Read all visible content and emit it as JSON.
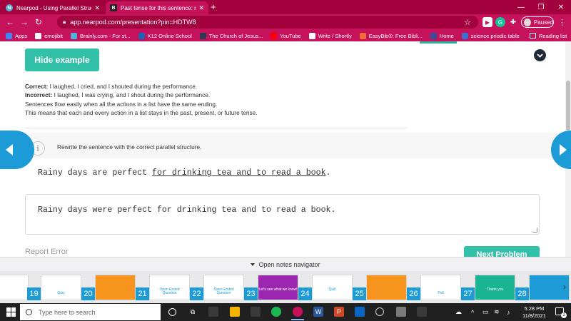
{
  "browser": {
    "tabs": [
      {
        "title": "Nearpod - Using Parallel Structu",
        "icon": "nearpod-icon"
      },
      {
        "title": "Past tense for this sentence: rain",
        "icon": "brainly-icon"
      }
    ],
    "url": "app.nearpod.com/presentation?pin=HDTW8",
    "profile_status": "Paused",
    "bookmarks": [
      {
        "label": "Apps",
        "color": "#4285f4"
      },
      {
        "label": "emojibit",
        "color": "#ffffff"
      },
      {
        "label": "Brainly.com - For st...",
        "color": "#4fb3d9"
      },
      {
        "label": "K12 Online School",
        "color": "#1c63b7"
      },
      {
        "label": "The Church of Jesus...",
        "color": "#2b3a55"
      },
      {
        "label": "YouTube",
        "color": "#ff0000"
      },
      {
        "label": "Write / Shortly",
        "color": "#ffffff"
      },
      {
        "label": "EasyBib®: Free Bibli...",
        "color": "#f26a35"
      },
      {
        "label": "Home",
        "color": "#3b4a9c"
      },
      {
        "label": "science priodic table",
        "color": "#3b6fd4"
      }
    ],
    "reading_list": "Reading list"
  },
  "lesson": {
    "hide_example_label": "Hide example",
    "example": {
      "correct_label": "Correct:",
      "correct_text": " I laughed, I cried, and I shouted during the performance.",
      "incorrect_label": "Incorrect:",
      "incorrect_text": " I laughed, I was crying, and I shout during the performance.",
      "line3": "Sentences flow easily when all the actions in a list have the same ending.",
      "line4": "This means that each and every action in a list stays in the past, present, or future tense."
    },
    "instruction": "Rewrite the sentence with the correct parallel structure.",
    "prompt_plain": "Rainy days are perfect ",
    "prompt_underlined": "for drinking tea and to read a book",
    "prompt_end": ".",
    "answer": "Rainy days were perfect for drinking tea and to read a book.",
    "report_error": "Report Error",
    "next_problem": "Next Problem"
  },
  "notes_navigator": "Open notes navigator",
  "slides": [
    {
      "num": "19",
      "caption": "Quiz",
      "sub": "",
      "accent": "#ffffff"
    },
    {
      "num": "20",
      "caption": "",
      "sub": "",
      "accent": "#f7941d"
    },
    {
      "num": "21",
      "caption": "Question",
      "sub": "Open Ended",
      "accent": "#ffffff"
    },
    {
      "num": "22",
      "caption": "Question",
      "sub": "Open Ended",
      "accent": "#ffffff"
    },
    {
      "num": "23",
      "caption": "",
      "sub": "Let's see what we know!",
      "accent": "#9b27b0"
    },
    {
      "num": "24",
      "caption": "",
      "sub": "Quill",
      "accent": "#ffffff"
    },
    {
      "num": "25",
      "caption": "",
      "sub": "",
      "accent": "#f7941d"
    },
    {
      "num": "26",
      "caption": "Poll",
      "sub": "",
      "accent": "#ffffff"
    },
    {
      "num": "27",
      "caption": "",
      "sub": "Thank you",
      "accent": "#1ab394"
    },
    {
      "num": "28",
      "caption": "",
      "sub": "",
      "accent": "#1c9bd7"
    }
  ],
  "taskbar": {
    "search_placeholder": "Type here to search",
    "time": "5:28 PM",
    "date": "11/8/2021",
    "notification_count": "2"
  }
}
